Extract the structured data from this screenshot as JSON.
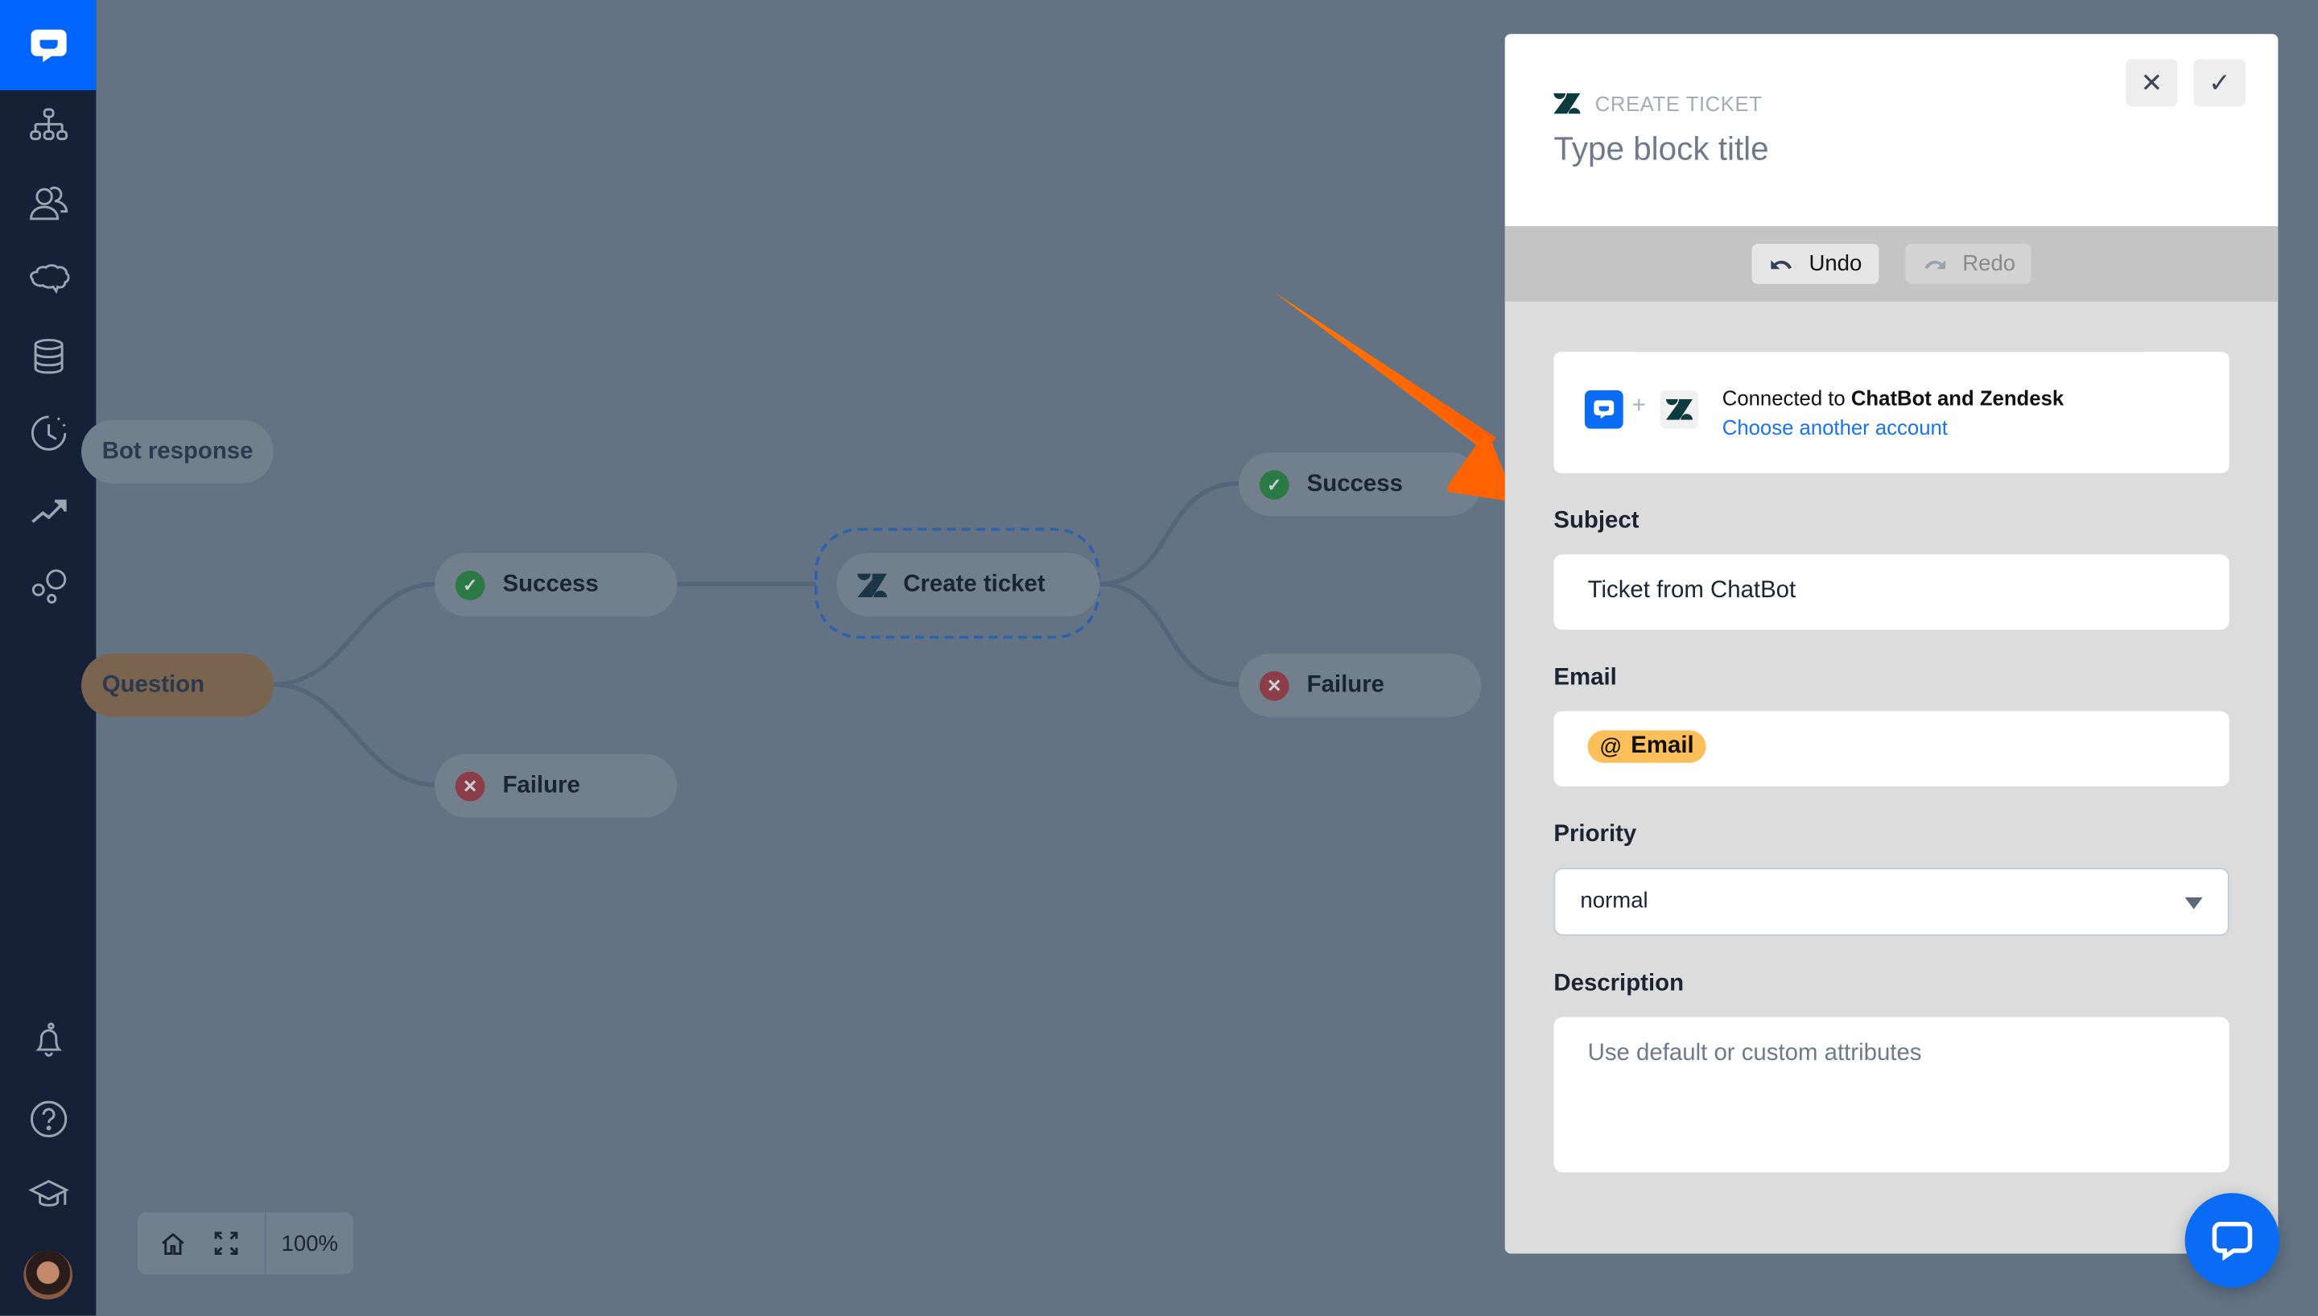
{
  "sidebar": {
    "logo": "chatbot-logo",
    "items": [
      {
        "name": "stories",
        "icon": "sitemap-icon"
      },
      {
        "name": "audience",
        "icon": "users-icon"
      },
      {
        "name": "training",
        "icon": "brain-icon"
      },
      {
        "name": "data",
        "icon": "database-icon"
      },
      {
        "name": "history",
        "icon": "history-icon"
      },
      {
        "name": "reports",
        "icon": "trend-icon"
      },
      {
        "name": "integrations",
        "icon": "bubbles-icon"
      }
    ],
    "bottom_items": [
      {
        "name": "notifications",
        "icon": "bell-icon"
      },
      {
        "name": "help",
        "icon": "help-icon"
      },
      {
        "name": "academy",
        "icon": "graduation-cap-icon"
      }
    ]
  },
  "canvas": {
    "nodes": {
      "bot_response": "Bot response",
      "question": "Question",
      "success_1": "Success",
      "failure_1": "Failure",
      "create_ticket": "Create ticket",
      "success_2": "Success",
      "failure_2": "Failure"
    },
    "zoom_level": "100%"
  },
  "panel": {
    "kicker": "CREATE TICKET",
    "title": "Type block title",
    "close_label": "✕",
    "confirm_label": "✓",
    "undo_label": "Undo",
    "redo_label": "Redo",
    "connection": {
      "prefix": "Connected to ",
      "services": "ChatBot and Zendesk",
      "link": "Choose another account"
    },
    "subject": {
      "label": "Subject",
      "value": "Ticket from ChatBot"
    },
    "email": {
      "label": "Email",
      "chip": "Email",
      "chip_icon": "@"
    },
    "priority": {
      "label": "Priority",
      "value": "normal"
    },
    "description": {
      "label": "Description",
      "placeholder": "Use default or custom attributes"
    }
  },
  "colors": {
    "brand": "#0066ff",
    "sidebar": "#162137",
    "overlay": "#637384",
    "annotation_arrow": "#ff6a00",
    "chip": "#fdbf5a",
    "link": "#1a73e8"
  }
}
